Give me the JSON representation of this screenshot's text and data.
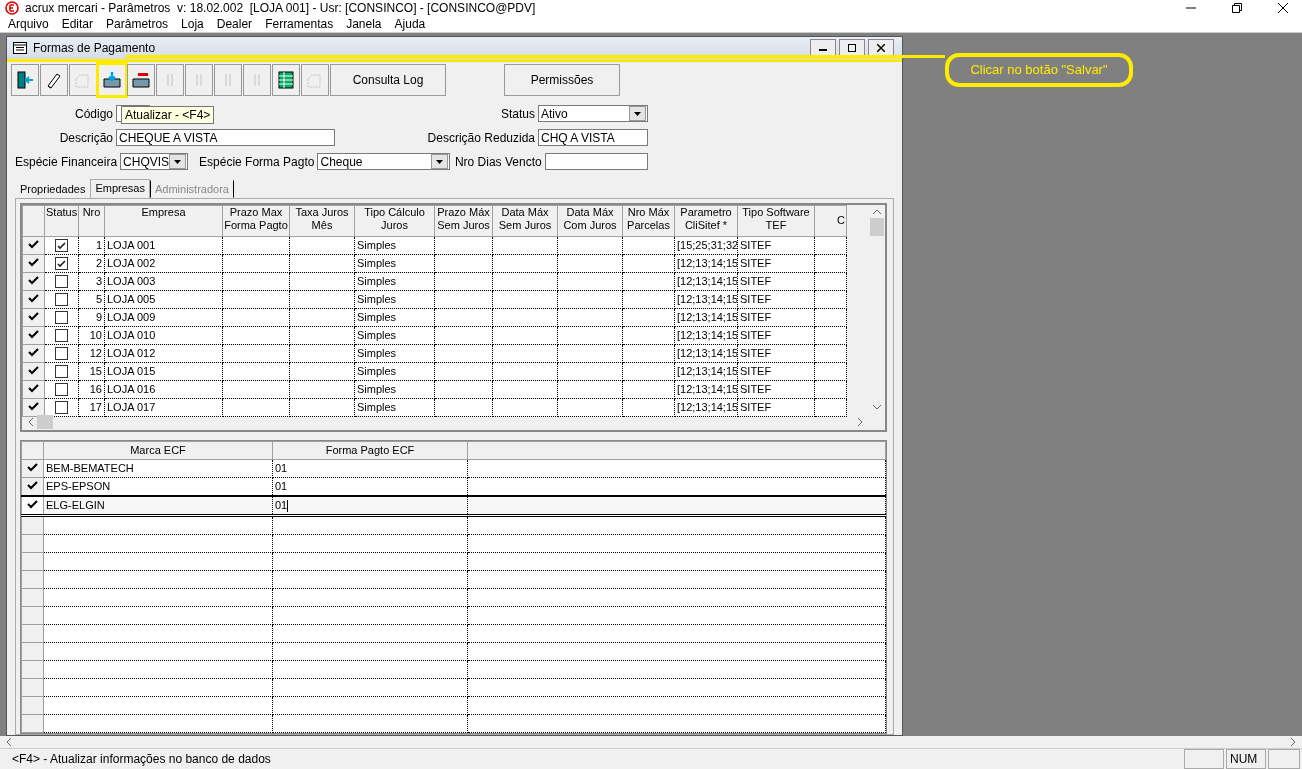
{
  "window": {
    "title": "acrux mercari - Parâmetros  v: 18.02.002  [LOJA 001] - Usr: [CONSINCO] - [CONSINCO@PDV]"
  },
  "menu": [
    "Arquivo",
    "Editar",
    "Parâmetros",
    "Loja",
    "Dealer",
    "Ferramentas",
    "Janela",
    "Ajuda"
  ],
  "child_window": {
    "title": "Formas de Pagamento"
  },
  "toolbar": [
    {
      "kind": "exit",
      "disabled": false,
      "highlighted": false
    },
    {
      "kind": "eraser",
      "disabled": false,
      "highlighted": false
    },
    {
      "kind": "new",
      "disabled": true,
      "highlighted": false
    },
    {
      "kind": "save",
      "disabled": false,
      "highlighted": true
    },
    {
      "kind": "delete",
      "disabled": false,
      "highlighted": false
    },
    {
      "kind": "first",
      "disabled": true,
      "highlighted": false
    },
    {
      "kind": "prev",
      "disabled": true,
      "highlighted": false
    },
    {
      "kind": "next",
      "disabled": true,
      "highlighted": false
    },
    {
      "kind": "last",
      "disabled": true,
      "highlighted": false
    },
    {
      "kind": "grid",
      "disabled": false,
      "highlighted": false
    },
    {
      "kind": "copy",
      "disabled": true,
      "highlighted": false
    }
  ],
  "toolbar_buttons": [
    "Consulta Log",
    "Permissões"
  ],
  "tooltip": "Atualizar - <F4>",
  "form": {
    "codigo_label": "Código",
    "status_label": "Status",
    "status_value": "Ativo",
    "descricao_label": "Descrição",
    "descricao_value": "CHEQUE A VISTA",
    "descricao_reduzida_label": "Descrição Reduzida",
    "descricao_reduzida_value": "CHQ A VISTA",
    "especie_financeira_label": "Espécie Financeira",
    "especie_financeira_value": "CHQVIS",
    "especie_forma_label": "Espécie Forma Pagto",
    "especie_forma_value": "Cheque",
    "nro_dias_label": "Nro Dias Vencto"
  },
  "tabs": [
    {
      "label": "Propriedades",
      "selected": false,
      "disabled": false
    },
    {
      "label": "Empresas",
      "selected": true,
      "disabled": false
    },
    {
      "label": "Administradora",
      "selected": false,
      "disabled": true
    }
  ],
  "empresas_table": {
    "columns": [
      "Status",
      "Nro",
      "Empresa",
      "Prazo Max Forma Pagto",
      "Taxa Juros Mês",
      "Tipo Cálculo Juros",
      "Prazo Máx Sem Juros",
      "Data Máx Sem Juros",
      "Data Máx Com Juros",
      "Nro Máx Parcelas",
      "Parametro CliSitef *",
      "Tipo Software TEF",
      "C"
    ],
    "rows": [
      {
        "checked": true,
        "nro": "1",
        "empresa": "LOJA 001",
        "tipo": "Simples",
        "parametro": "[15;25;31;32",
        "software": "SITEF"
      },
      {
        "checked": true,
        "nro": "2",
        "empresa": "LOJA 002",
        "tipo": "Simples",
        "parametro": "[12;13;14;15",
        "software": "SITEF"
      },
      {
        "checked": false,
        "nro": "3",
        "empresa": "LOJA 003",
        "tipo": "Simples",
        "parametro": "[12;13;14;15",
        "software": "SITEF"
      },
      {
        "checked": false,
        "nro": "5",
        "empresa": "LOJA 005",
        "tipo": "Simples",
        "parametro": "[12;13;14;15",
        "software": "SITEF"
      },
      {
        "checked": false,
        "nro": "9",
        "empresa": "LOJA 009",
        "tipo": "Simples",
        "parametro": "[12;13;14;15",
        "software": "SITEF"
      },
      {
        "checked": false,
        "nro": "10",
        "empresa": "LOJA 010",
        "tipo": "Simples",
        "parametro": "[12;13;14;15",
        "software": "SITEF"
      },
      {
        "checked": false,
        "nro": "12",
        "empresa": "LOJA 012",
        "tipo": "Simples",
        "parametro": "[12;13;14;15",
        "software": "SITEF"
      },
      {
        "checked": false,
        "nro": "15",
        "empresa": "LOJA 015",
        "tipo": "Simples",
        "parametro": "[12;13;14;15",
        "software": "SITEF"
      },
      {
        "checked": false,
        "nro": "16",
        "empresa": "LOJA 016",
        "tipo": "Simples",
        "parametro": "[12;13;14;15",
        "software": "SITEF"
      },
      {
        "checked": false,
        "nro": "17",
        "empresa": "LOJA 017",
        "tipo": "Simples",
        "parametro": "[12;13;14;15",
        "software": "SITEF"
      }
    ]
  },
  "ecf_table": {
    "columns": [
      "Marca ECF",
      "Forma Pagto ECF"
    ],
    "rows": [
      {
        "marca": "BEM-BEMATECH",
        "forma": "01",
        "selected": false
      },
      {
        "marca": "EPS-EPSON",
        "forma": "01",
        "selected": false
      },
      {
        "marca": "ELG-ELGIN",
        "forma": "01",
        "selected": true
      }
    ]
  },
  "callout": "Clicar no botão \"Salvar\"",
  "status_bar": {
    "message": "<F4> - Atualizar informações no banco de dados",
    "num_panel": "NUM"
  }
}
